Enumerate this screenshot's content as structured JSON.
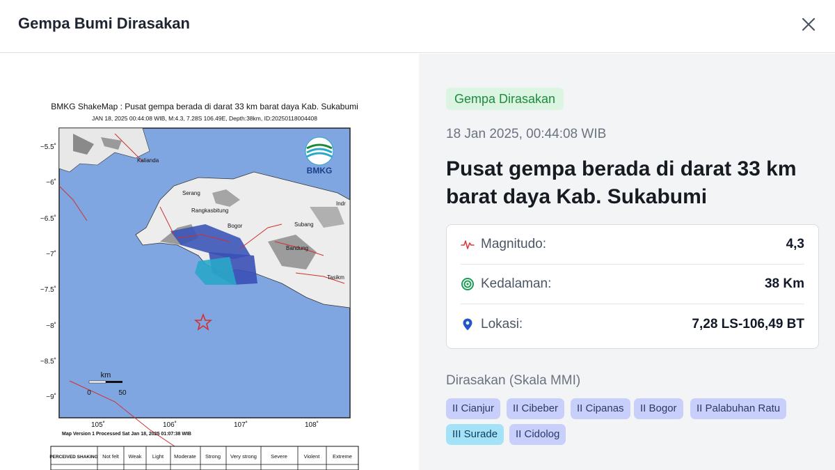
{
  "header": {
    "title": "Gempa Bumi Dirasakan",
    "close_icon": "close-icon"
  },
  "badge": {
    "label": "Gempa Dirasakan",
    "color": "#1e8a3c"
  },
  "event": {
    "datetime": "18 Jan 2025, 00:44:08 WIB",
    "headline": "Pusat gempa berada di darat 33 km barat daya Kab. Sukabumi"
  },
  "details": {
    "magnitude": {
      "label": "Magnitudo:",
      "value": "4,3",
      "icon": "pulse-icon"
    },
    "depth": {
      "label": "Kedalaman:",
      "value": "38 Km",
      "icon": "target-icon"
    },
    "location": {
      "label": "Lokasi:",
      "value": "7,28 LS-106,49 BT",
      "icon": "map-pin-icon"
    }
  },
  "mmi": {
    "title": "Dirasakan (Skala MMI)",
    "items": [
      {
        "label": "II Cianjur",
        "level": 2
      },
      {
        "label": "II Cibeber",
        "level": 2
      },
      {
        "label": "II Cipanas",
        "level": 2
      },
      {
        "label": "II Bogor",
        "level": 2
      },
      {
        "label": "II Palabuhan Ratu",
        "level": 2
      },
      {
        "label": "III Surade",
        "level": 3
      },
      {
        "label": "II Cidolog",
        "level": 2
      }
    ]
  },
  "shakemap": {
    "title": "BMKG ShakeMap : Pusat gempa berada di darat 33 km barat daya Kab. Sukabumi",
    "subtitle": "JAN 18, 2025 00:44:08 WIB, M:4.3, 7.28S 106.49E, Depth:38km, ID:20250118004408",
    "logo": "BMKG",
    "lat_ticks": [
      "−5.5˚",
      "−6˚",
      "−6.5˚",
      "−7˚",
      "−7.5˚",
      "−8˚",
      "−8.5˚",
      "−9˚"
    ],
    "lon_ticks": [
      "105˚",
      "106˚",
      "107˚",
      "108˚"
    ],
    "cities": [
      "Kalianda",
      "Serang",
      "Rangkasbitung",
      "Bogor",
      "Subang",
      "Bandung",
      "Tasikm",
      "Indr"
    ],
    "scale": {
      "unit": "km",
      "start": "0",
      "end": "50"
    },
    "footer": "Map Version 1 Processed Sat Jan 18, 2025 01:07:38 WIB",
    "legend_header": [
      "PERCEIVED SHAKING",
      "Not felt",
      "Weak",
      "Light",
      "Moderate",
      "Strong",
      "Very strong",
      "Severe",
      "Violent",
      "Extreme"
    ]
  }
}
